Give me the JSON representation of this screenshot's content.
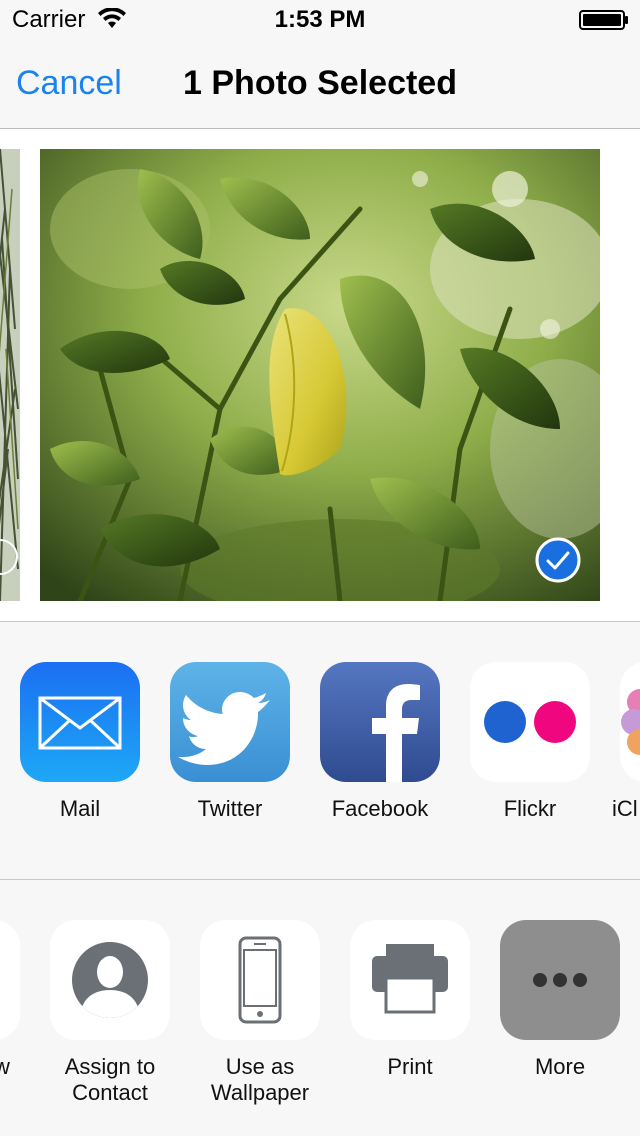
{
  "status_bar": {
    "carrier": "Carrier",
    "time": "1:53 PM"
  },
  "nav": {
    "cancel_label": "Cancel",
    "title": "1 Photo Selected"
  },
  "share_apps": [
    {
      "label": "Mail",
      "icon": "mail-icon"
    },
    {
      "label": "Twitter",
      "icon": "twitter-icon"
    },
    {
      "label": "Facebook",
      "icon": "facebook-icon"
    },
    {
      "label": "Flickr",
      "icon": "flickr-icon"
    },
    {
      "label": "iCl",
      "icon": "icloud-icon"
    }
  ],
  "actions": [
    {
      "label": "w",
      "icon": "partial-icon"
    },
    {
      "label": "Assign to Contact",
      "icon": "contact-icon"
    },
    {
      "label": "Use as Wallpaper",
      "icon": "wallpaper-icon"
    },
    {
      "label": "Print",
      "icon": "printer-icon"
    },
    {
      "label": "More",
      "icon": "more-icon"
    }
  ],
  "colors": {
    "accent": "#1a83f0",
    "mail": "#1e7cf3",
    "twitter": "#4aa3e0",
    "facebook": "#3b5998",
    "more_bg": "#8e8e8e"
  }
}
